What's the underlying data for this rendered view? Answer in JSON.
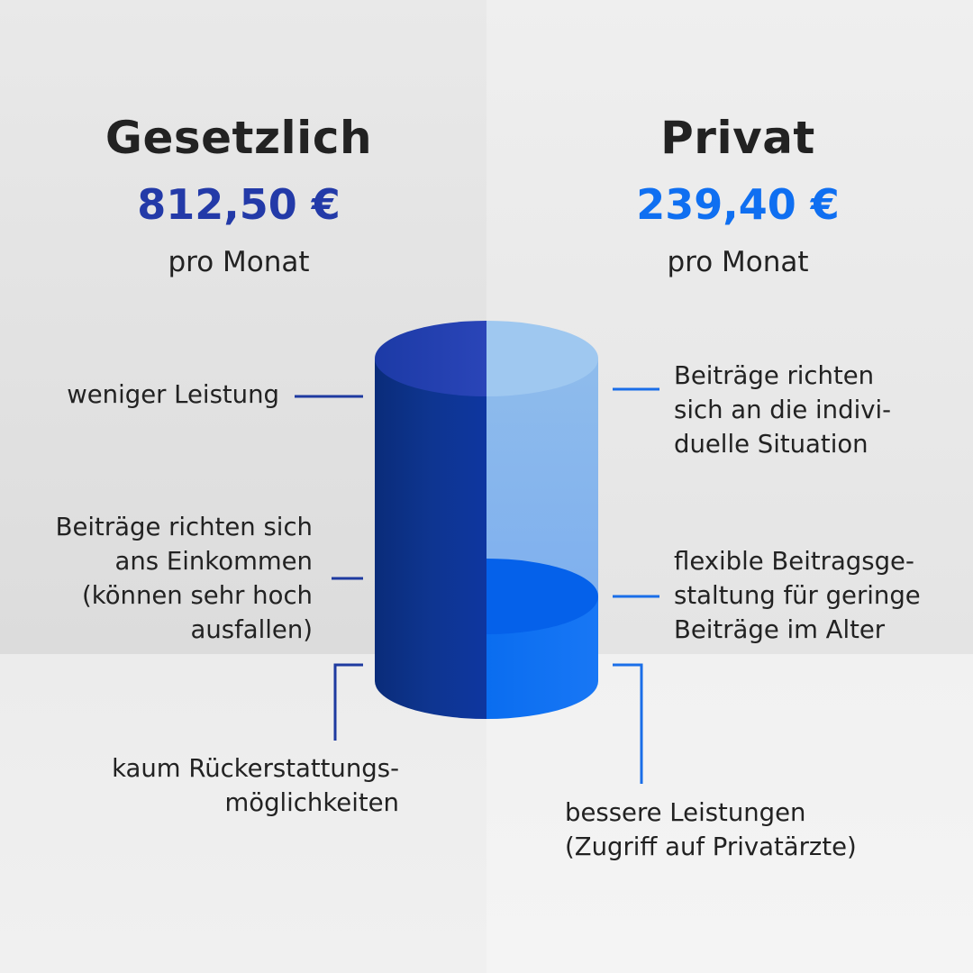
{
  "left": {
    "title": "Gesetzlich",
    "price": "812,50 €",
    "unit": "pro Monat",
    "fill_fraction": 1.0,
    "color": "#233aa8",
    "points": [
      "weniger Leistung",
      "Beiträge richten sich\nans Einkommen\n(können sehr hoch\nausfallen)",
      "kaum Rückerstattungs-\nmöglichkeiten"
    ]
  },
  "right": {
    "title": "Privat",
    "price": "239,40 €",
    "unit": "pro Monat",
    "fill_fraction": 0.3,
    "color": "#0f6ff1",
    "points": [
      "Beiträge richten\nsich an die indivi-\nduelle Situation",
      "flexible Beitragsge-\nstaltung für geringe\nBeiträge im Alter",
      "bessere Leistungen\n(Zugriff auf Privatärzte)"
    ]
  }
}
